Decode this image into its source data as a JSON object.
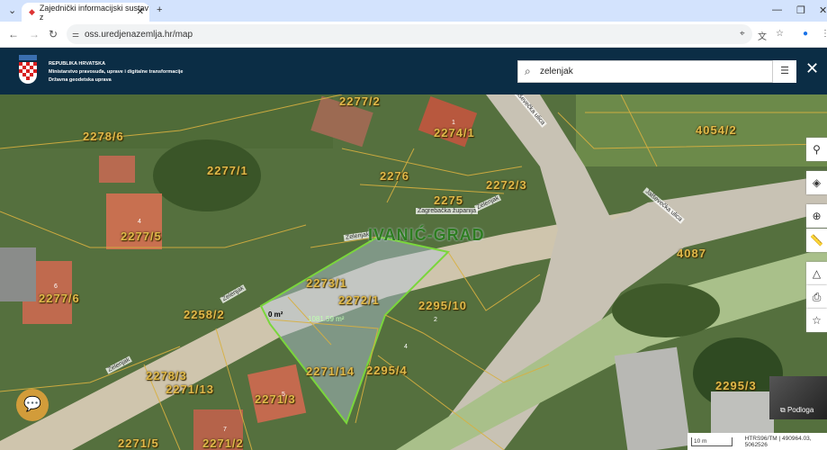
{
  "browser": {
    "tab_title": "Zajednički informacijski sustav z",
    "url": "oss.uredjenazemlja.hr/map"
  },
  "header": {
    "line1": "REPUBLIKA HRVATSKA",
    "line2": "Ministarstvo pravosuđa, uprave i digitalne transformacije",
    "line3": "Državna geodetska uprava"
  },
  "search": {
    "value": "zelenjak"
  },
  "map": {
    "city": "IVANIĆ-GRAD",
    "parcels": [
      "2277/2",
      "2274/1",
      "2278/6",
      "2277/1",
      "2276",
      "2275",
      "2272/3",
      "4054/2",
      "2277/5",
      "2277/6",
      "2273/1",
      "2272/1",
      "2295/10",
      "2258/2",
      "2271/14",
      "2295/4",
      "2278/3",
      "2271/13",
      "2271/3",
      "2271/5",
      "2271/2",
      "4087",
      "2295/3"
    ],
    "streets": [
      "Zagrebačka županija",
      "Zelenjak",
      "Zelenjak",
      "Zelenjak",
      "Zelenjak",
      "Jalševečka ulica",
      "Jalševečka ulica"
    ],
    "area_label": "1081.59 m²",
    "zero_label": "0 m²",
    "house_numbers": [
      "1",
      "4",
      "6",
      "2",
      "4",
      "5",
      "7"
    ]
  },
  "basemap_label": "Podloga",
  "scale": {
    "label": "10 m",
    "coords": "HTRS96/TM | 490964.03, 5062526"
  }
}
